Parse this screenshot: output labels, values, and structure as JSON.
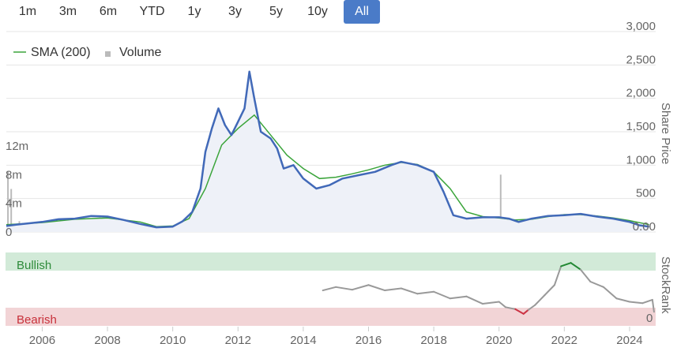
{
  "range_buttons": [
    {
      "label": "1m",
      "active": false
    },
    {
      "label": "3m",
      "active": false
    },
    {
      "label": "6m",
      "active": false
    },
    {
      "label": "YTD",
      "active": false
    },
    {
      "label": "1y",
      "active": false
    },
    {
      "label": "3y",
      "active": false
    },
    {
      "label": "5y",
      "active": false
    },
    {
      "label": "10y",
      "active": false
    },
    {
      "label": "All",
      "active": true
    }
  ],
  "legend": {
    "sma_label": "SMA (200)",
    "volume_label": "Volume"
  },
  "colors": {
    "price": "#4169b8",
    "price_fill": "#eef1f8",
    "sma": "#3aa43a",
    "volume": "#bbbbbb",
    "bullish_band": "#d2ead8",
    "bearish_band": "#f2d4d6",
    "bullish_text": "#2e8b3a",
    "bearish_text": "#c8303a",
    "rank_neutral": "#999999",
    "rank_bull": "#228833",
    "rank_bear": "#cc3344",
    "accent": "#4a7bc8"
  },
  "chart_data": [
    {
      "type": "line",
      "yaxis_right_title": "Share Price",
      "yaxis_right_ticks": [
        "3,000",
        "2,500",
        "2,000",
        "1,500",
        "1,000",
        "500",
        "0.00"
      ],
      "yaxis_right_range": [
        0,
        3000
      ],
      "yaxis_left_ticks": [
        "12m",
        "8m",
        "4m",
        "0"
      ],
      "yaxis_left_range": [
        0,
        14
      ],
      "x_range": [
        2004.9,
        2024.8
      ],
      "series": [
        {
          "name": "Share Price",
          "kind": "price",
          "points": [
            [
              2004.9,
              90
            ],
            [
              2005.2,
              110
            ],
            [
              2005.6,
              130
            ],
            [
              2006.0,
              150
            ],
            [
              2006.5,
              190
            ],
            [
              2007.0,
              200
            ],
            [
              2007.5,
              240
            ],
            [
              2008.0,
              230
            ],
            [
              2008.5,
              180
            ],
            [
              2009.0,
              120
            ],
            [
              2009.5,
              70
            ],
            [
              2010.0,
              80
            ],
            [
              2010.3,
              160
            ],
            [
              2010.6,
              300
            ],
            [
              2010.85,
              650
            ],
            [
              2011.0,
              1200
            ],
            [
              2011.2,
              1550
            ],
            [
              2011.4,
              1850
            ],
            [
              2011.6,
              1600
            ],
            [
              2011.8,
              1450
            ],
            [
              2012.0,
              1650
            ],
            [
              2012.2,
              1850
            ],
            [
              2012.35,
              2400
            ],
            [
              2012.5,
              2000
            ],
            [
              2012.7,
              1500
            ],
            [
              2013.0,
              1400
            ],
            [
              2013.2,
              1250
            ],
            [
              2013.4,
              950
            ],
            [
              2013.7,
              1000
            ],
            [
              2014.0,
              800
            ],
            [
              2014.4,
              650
            ],
            [
              2014.8,
              700
            ],
            [
              2015.2,
              800
            ],
            [
              2015.7,
              850
            ],
            [
              2016.2,
              900
            ],
            [
              2016.7,
              1000
            ],
            [
              2017.0,
              1050
            ],
            [
              2017.5,
              1000
            ],
            [
              2018.0,
              900
            ],
            [
              2018.3,
              600
            ],
            [
              2018.6,
              250
            ],
            [
              2019.0,
              200
            ],
            [
              2019.5,
              220
            ],
            [
              2020.0,
              220
            ],
            [
              2020.3,
              200
            ],
            [
              2020.6,
              150
            ],
            [
              2021.0,
              200
            ],
            [
              2021.5,
              240
            ],
            [
              2022.0,
              250
            ],
            [
              2022.5,
              270
            ],
            [
              2023.0,
              230
            ],
            [
              2023.5,
              200
            ],
            [
              2024.0,
              150
            ],
            [
              2024.3,
              100
            ],
            [
              2024.6,
              80
            ]
          ]
        },
        {
          "name": "SMA (200)",
          "kind": "sma",
          "points": [
            [
              2004.9,
              110
            ],
            [
              2006.0,
              140
            ],
            [
              2007.0,
              190
            ],
            [
              2008.0,
              210
            ],
            [
              2009.0,
              150
            ],
            [
              2009.5,
              80
            ],
            [
              2010.0,
              90
            ],
            [
              2010.5,
              200
            ],
            [
              2011.0,
              650
            ],
            [
              2011.5,
              1300
            ],
            [
              2012.0,
              1550
            ],
            [
              2012.5,
              1750
            ],
            [
              2013.0,
              1450
            ],
            [
              2013.5,
              1150
            ],
            [
              2014.0,
              950
            ],
            [
              2014.5,
              800
            ],
            [
              2015.0,
              820
            ],
            [
              2015.5,
              870
            ],
            [
              2016.0,
              930
            ],
            [
              2016.5,
              1000
            ],
            [
              2017.0,
              1040
            ],
            [
              2017.5,
              1010
            ],
            [
              2018.0,
              900
            ],
            [
              2018.5,
              650
            ],
            [
              2019.0,
              300
            ],
            [
              2019.5,
              230
            ],
            [
              2020.0,
              210
            ],
            [
              2020.5,
              180
            ],
            [
              2021.0,
              190
            ],
            [
              2021.5,
              230
            ],
            [
              2022.0,
              260
            ],
            [
              2022.5,
              260
            ],
            [
              2023.0,
              240
            ],
            [
              2023.5,
              210
            ],
            [
              2024.0,
              170
            ],
            [
              2024.6,
              110
            ]
          ]
        },
        {
          "name": "Volume",
          "kind": "volume",
          "unit": "m",
          "points": [
            [
              2004.95,
              8.5
            ],
            [
              2005.05,
              6
            ],
            [
              2005.3,
              1.5
            ],
            [
              2005.6,
              1
            ],
            [
              2006.2,
              0.8
            ],
            [
              2006.6,
              1.2
            ],
            [
              2007.2,
              1
            ],
            [
              2007.8,
              0.7
            ],
            [
              2008.4,
              0.5
            ],
            [
              2009.0,
              0.6
            ],
            [
              2009.7,
              0.4
            ],
            [
              2010.6,
              0.9
            ],
            [
              2010.9,
              0.7
            ],
            [
              2011.1,
              1
            ],
            [
              2011.5,
              0.8
            ],
            [
              2011.9,
              0.9
            ],
            [
              2012.3,
              0.7
            ],
            [
              2012.7,
              0.6
            ],
            [
              2013.1,
              0.8
            ],
            [
              2013.6,
              0.5
            ],
            [
              2014.0,
              0.4
            ],
            [
              2018.6,
              1.3
            ],
            [
              2020.05,
              8
            ],
            [
              2021.5,
              0.5
            ],
            [
              2022.4,
              0.4
            ]
          ]
        }
      ]
    },
    {
      "type": "line",
      "title": "StockRank",
      "band_labels": [
        "Bullish",
        "Bearish"
      ],
      "yaxis_ticks": [
        "0"
      ],
      "y_range": [
        0,
        100
      ],
      "x_ticks": [
        "2006",
        "2008",
        "2010",
        "2012",
        "2014",
        "2016",
        "2018",
        "2020",
        "2022",
        "2024"
      ],
      "x_tick_values": [
        2006,
        2008,
        2010,
        2012,
        2014,
        2016,
        2018,
        2020,
        2022,
        2024
      ],
      "series": [
        {
          "name": "StockRank",
          "points": [
            [
              2014.6,
              47
            ],
            [
              2015.0,
              52
            ],
            [
              2015.5,
              48
            ],
            [
              2016.0,
              55
            ],
            [
              2016.5,
              47
            ],
            [
              2017.0,
              50
            ],
            [
              2017.5,
              42
            ],
            [
              2018.0,
              45
            ],
            [
              2018.5,
              35
            ],
            [
              2019.0,
              38
            ],
            [
              2019.5,
              27
            ],
            [
              2020.0,
              30
            ],
            [
              2020.2,
              22
            ],
            [
              2020.5,
              19
            ],
            [
              2020.75,
              12
            ],
            [
              2020.9,
              18
            ],
            [
              2021.1,
              25
            ],
            [
              2021.4,
              40
            ],
            [
              2021.7,
              55
            ],
            [
              2021.9,
              83
            ],
            [
              2022.2,
              88
            ],
            [
              2022.5,
              78
            ],
            [
              2022.8,
              60
            ],
            [
              2023.2,
              52
            ],
            [
              2023.6,
              35
            ],
            [
              2024.0,
              30
            ],
            [
              2024.4,
              28
            ],
            [
              2024.7,
              33
            ],
            [
              2024.75,
              15
            ]
          ]
        }
      ]
    }
  ]
}
